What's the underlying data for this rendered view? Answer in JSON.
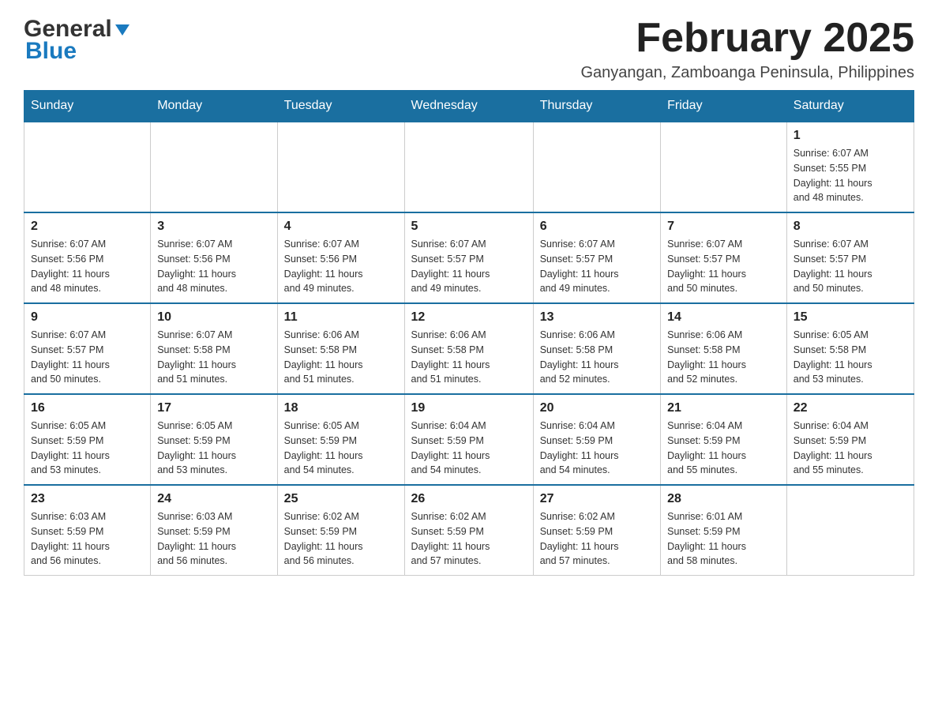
{
  "header": {
    "logo_general": "General",
    "logo_blue": "Blue",
    "month_title": "February 2025",
    "location": "Ganyangan, Zamboanga Peninsula, Philippines"
  },
  "weekdays": [
    "Sunday",
    "Monday",
    "Tuesday",
    "Wednesday",
    "Thursday",
    "Friday",
    "Saturday"
  ],
  "weeks": [
    [
      {
        "day": "",
        "info": ""
      },
      {
        "day": "",
        "info": ""
      },
      {
        "day": "",
        "info": ""
      },
      {
        "day": "",
        "info": ""
      },
      {
        "day": "",
        "info": ""
      },
      {
        "day": "",
        "info": ""
      },
      {
        "day": "1",
        "info": "Sunrise: 6:07 AM\nSunset: 5:55 PM\nDaylight: 11 hours\nand 48 minutes."
      }
    ],
    [
      {
        "day": "2",
        "info": "Sunrise: 6:07 AM\nSunset: 5:56 PM\nDaylight: 11 hours\nand 48 minutes."
      },
      {
        "day": "3",
        "info": "Sunrise: 6:07 AM\nSunset: 5:56 PM\nDaylight: 11 hours\nand 48 minutes."
      },
      {
        "day": "4",
        "info": "Sunrise: 6:07 AM\nSunset: 5:56 PM\nDaylight: 11 hours\nand 49 minutes."
      },
      {
        "day": "5",
        "info": "Sunrise: 6:07 AM\nSunset: 5:57 PM\nDaylight: 11 hours\nand 49 minutes."
      },
      {
        "day": "6",
        "info": "Sunrise: 6:07 AM\nSunset: 5:57 PM\nDaylight: 11 hours\nand 49 minutes."
      },
      {
        "day": "7",
        "info": "Sunrise: 6:07 AM\nSunset: 5:57 PM\nDaylight: 11 hours\nand 50 minutes."
      },
      {
        "day": "8",
        "info": "Sunrise: 6:07 AM\nSunset: 5:57 PM\nDaylight: 11 hours\nand 50 minutes."
      }
    ],
    [
      {
        "day": "9",
        "info": "Sunrise: 6:07 AM\nSunset: 5:57 PM\nDaylight: 11 hours\nand 50 minutes."
      },
      {
        "day": "10",
        "info": "Sunrise: 6:07 AM\nSunset: 5:58 PM\nDaylight: 11 hours\nand 51 minutes."
      },
      {
        "day": "11",
        "info": "Sunrise: 6:06 AM\nSunset: 5:58 PM\nDaylight: 11 hours\nand 51 minutes."
      },
      {
        "day": "12",
        "info": "Sunrise: 6:06 AM\nSunset: 5:58 PM\nDaylight: 11 hours\nand 51 minutes."
      },
      {
        "day": "13",
        "info": "Sunrise: 6:06 AM\nSunset: 5:58 PM\nDaylight: 11 hours\nand 52 minutes."
      },
      {
        "day": "14",
        "info": "Sunrise: 6:06 AM\nSunset: 5:58 PM\nDaylight: 11 hours\nand 52 minutes."
      },
      {
        "day": "15",
        "info": "Sunrise: 6:05 AM\nSunset: 5:58 PM\nDaylight: 11 hours\nand 53 minutes."
      }
    ],
    [
      {
        "day": "16",
        "info": "Sunrise: 6:05 AM\nSunset: 5:59 PM\nDaylight: 11 hours\nand 53 minutes."
      },
      {
        "day": "17",
        "info": "Sunrise: 6:05 AM\nSunset: 5:59 PM\nDaylight: 11 hours\nand 53 minutes."
      },
      {
        "day": "18",
        "info": "Sunrise: 6:05 AM\nSunset: 5:59 PM\nDaylight: 11 hours\nand 54 minutes."
      },
      {
        "day": "19",
        "info": "Sunrise: 6:04 AM\nSunset: 5:59 PM\nDaylight: 11 hours\nand 54 minutes."
      },
      {
        "day": "20",
        "info": "Sunrise: 6:04 AM\nSunset: 5:59 PM\nDaylight: 11 hours\nand 54 minutes."
      },
      {
        "day": "21",
        "info": "Sunrise: 6:04 AM\nSunset: 5:59 PM\nDaylight: 11 hours\nand 55 minutes."
      },
      {
        "day": "22",
        "info": "Sunrise: 6:04 AM\nSunset: 5:59 PM\nDaylight: 11 hours\nand 55 minutes."
      }
    ],
    [
      {
        "day": "23",
        "info": "Sunrise: 6:03 AM\nSunset: 5:59 PM\nDaylight: 11 hours\nand 56 minutes."
      },
      {
        "day": "24",
        "info": "Sunrise: 6:03 AM\nSunset: 5:59 PM\nDaylight: 11 hours\nand 56 minutes."
      },
      {
        "day": "25",
        "info": "Sunrise: 6:02 AM\nSunset: 5:59 PM\nDaylight: 11 hours\nand 56 minutes."
      },
      {
        "day": "26",
        "info": "Sunrise: 6:02 AM\nSunset: 5:59 PM\nDaylight: 11 hours\nand 57 minutes."
      },
      {
        "day": "27",
        "info": "Sunrise: 6:02 AM\nSunset: 5:59 PM\nDaylight: 11 hours\nand 57 minutes."
      },
      {
        "day": "28",
        "info": "Sunrise: 6:01 AM\nSunset: 5:59 PM\nDaylight: 11 hours\nand 58 minutes."
      },
      {
        "day": "",
        "info": ""
      }
    ]
  ]
}
